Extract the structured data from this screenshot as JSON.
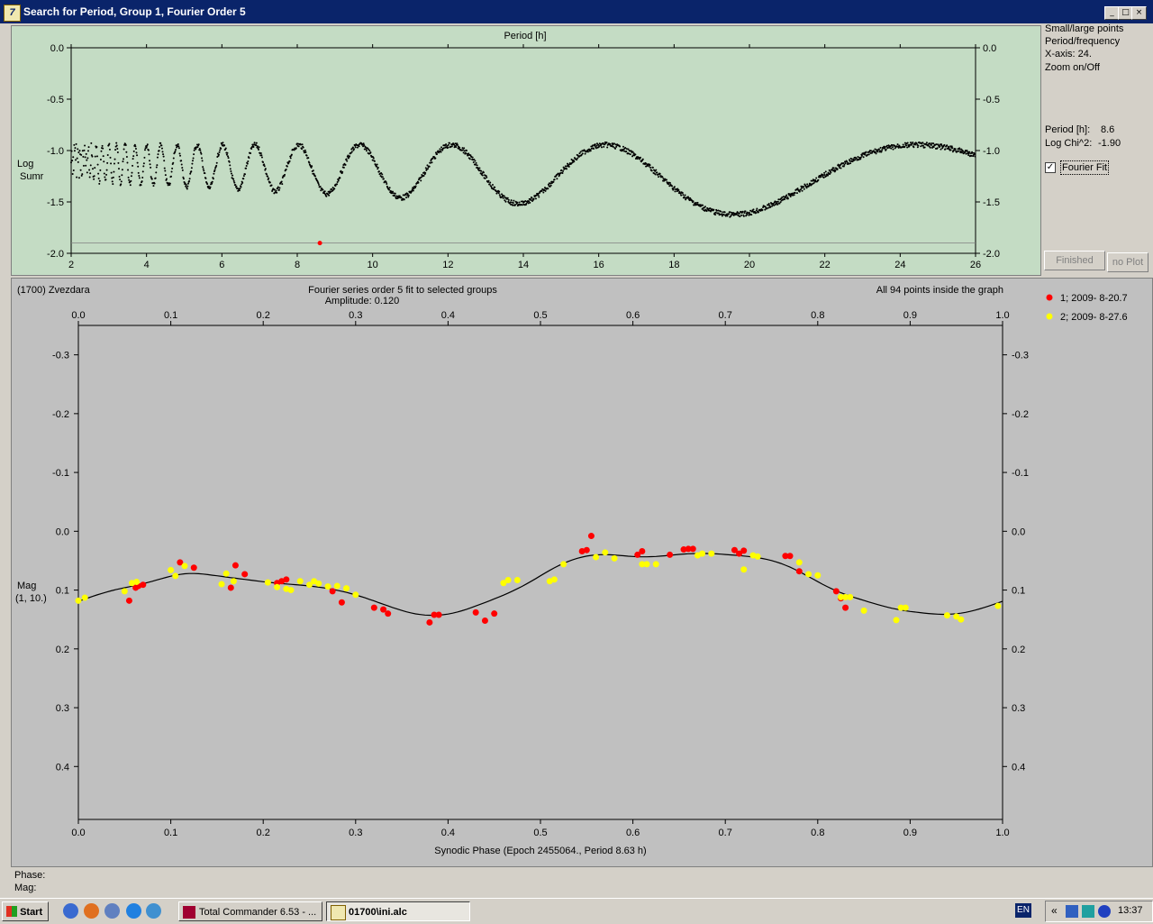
{
  "window": {
    "title": "Search for Period, Group 1, Fourier Order 5",
    "app_icon": "7"
  },
  "periodogram": {
    "top_label": "Period [h]",
    "ylabel_line1": "Log",
    "ylabel_line2": "Sumr",
    "x_ticks": [
      "2",
      "4",
      "6",
      "8",
      "10",
      "12",
      "14",
      "16",
      "18",
      "20",
      "22",
      "24",
      "26"
    ],
    "y_ticks": [
      "0.0",
      "-0.5",
      "-1.0",
      "-1.5",
      "-2.0"
    ],
    "bg": "#c4dcc4"
  },
  "side_panel": {
    "opt1": "Small/large points",
    "opt2": "Period/frequency",
    "opt3": "X-axis: 24.",
    "opt4": "Zoom on/Off",
    "period_label": "Period [h]:",
    "period_value": "8.6",
    "chi_label": "Log Chi^2:",
    "chi_value": "-1.90",
    "fourier_label": "Fourier Fit",
    "fourier_checked": true,
    "finished_label": "Finished",
    "noplot_label": "no Plot"
  },
  "lightcurve": {
    "object": "(1700) Zvezdara",
    "title1": "Fourier series order 5 fit to selected groups",
    "title2": "Amplitude: 0.120",
    "points_info": "All 94 points inside the graph",
    "ylabel_line1": "Mag",
    "ylabel_line2": "(1, 10.)",
    "x_ticks": [
      "0.0",
      "0.1",
      "0.2",
      "0.3",
      "0.4",
      "0.5",
      "0.6",
      "0.7",
      "0.8",
      "0.9",
      "1.0"
    ],
    "y_ticks": [
      "-0.3",
      "-0.2",
      "-0.1",
      "0.0",
      "0.1",
      "0.2",
      "0.3",
      "0.4"
    ],
    "xlabel": "Synodic Phase (Epoch 2455064., Period 8.63 h)",
    "legend": [
      {
        "label": "1; 2009- 8-20.7",
        "color": "#ff0000"
      },
      {
        "label": "2; 2009- 8-27.6",
        "color": "#ffff00"
      }
    ],
    "bg": "#c0c0c0"
  },
  "status": {
    "phase_label": "Phase:",
    "mag_label": "Mag:"
  },
  "chart_data": [
    {
      "type": "scatter",
      "xlabel": "Period [h]",
      "ylabel": "Log Sumr",
      "xlim": [
        2,
        26
      ],
      "ylim": [
        -2.0,
        0.0
      ],
      "best_period": {
        "x": 8.6,
        "y": -1.9
      }
    },
    {
      "type": "scatter",
      "title": "Fourier series order 5 fit to selected groups",
      "xlabel": "Synodic Phase (Epoch 2455064., Period 8.63 h)",
      "ylabel": "Mag (1, 10.)",
      "xlim": [
        0.0,
        1.0
      ],
      "ylim": [
        -0.35,
        0.49
      ],
      "y_inverted": true,
      "series": [
        {
          "name": "1; 2009- 8-20.7",
          "color": "#ff0000",
          "x": [
            0.055,
            0.062,
            0.065,
            0.07,
            0.11,
            0.125,
            0.165,
            0.17,
            0.18,
            0.215,
            0.22,
            0.225,
            0.275,
            0.285,
            0.32,
            0.33,
            0.335,
            0.38,
            0.385,
            0.39,
            0.43,
            0.44,
            0.45,
            0.545,
            0.55,
            0.555,
            0.605,
            0.61,
            0.64,
            0.655,
            0.66,
            0.665,
            0.71,
            0.715,
            0.72,
            0.765,
            0.77,
            0.78,
            0.82,
            0.825,
            0.83
          ],
          "y": [
            0.118,
            0.096,
            0.093,
            0.091,
            0.053,
            0.062,
            0.096,
            0.058,
            0.073,
            0.088,
            0.085,
            0.082,
            0.102,
            0.121,
            0.13,
            0.133,
            0.14,
            0.155,
            0.142,
            0.142,
            0.138,
            0.152,
            0.14,
            0.034,
            0.032,
            0.008,
            0.04,
            0.034,
            0.04,
            0.031,
            0.03,
            0.03,
            0.032,
            0.038,
            0.033,
            0.042,
            0.042,
            0.068,
            0.102,
            0.114,
            0.13
          ]
        },
        {
          "name": "2; 2009- 8-27.6",
          "color": "#ffff00",
          "x": [
            0.0,
            0.007,
            0.05,
            0.058,
            0.063,
            0.1,
            0.105,
            0.115,
            0.155,
            0.16,
            0.168,
            0.205,
            0.215,
            0.225,
            0.23,
            0.24,
            0.25,
            0.255,
            0.26,
            0.27,
            0.28,
            0.29,
            0.3,
            0.46,
            0.465,
            0.475,
            0.51,
            0.515,
            0.525,
            0.56,
            0.57,
            0.58,
            0.61,
            0.615,
            0.625,
            0.67,
            0.675,
            0.685,
            0.72,
            0.73,
            0.735,
            0.78,
            0.79,
            0.8,
            0.825,
            0.83,
            0.835,
            0.85,
            0.885,
            0.89,
            0.895,
            0.94,
            0.95,
            0.955,
            0.995
          ],
          "y": [
            0.118,
            0.113,
            0.102,
            0.088,
            0.086,
            0.066,
            0.076,
            0.059,
            0.09,
            0.072,
            0.085,
            0.087,
            0.095,
            0.098,
            0.1,
            0.085,
            0.091,
            0.085,
            0.089,
            0.094,
            0.093,
            0.097,
            0.108,
            0.088,
            0.083,
            0.083,
            0.085,
            0.082,
            0.056,
            0.044,
            0.036,
            0.046,
            0.056,
            0.056,
            0.056,
            0.041,
            0.038,
            0.038,
            0.065,
            0.041,
            0.043,
            0.053,
            0.073,
            0.075,
            0.112,
            0.112,
            0.112,
            0.135,
            0.151,
            0.13,
            0.13,
            0.143,
            0.145,
            0.15,
            0.127
          ]
        }
      ]
    }
  ],
  "taskbar": {
    "start_label": "Start",
    "task1_label": "Total Commander 6.53 - ...",
    "task2_label": "01700\\ini.alc",
    "lang": "EN",
    "tray_arrow": "«",
    "clock": "13:37"
  }
}
